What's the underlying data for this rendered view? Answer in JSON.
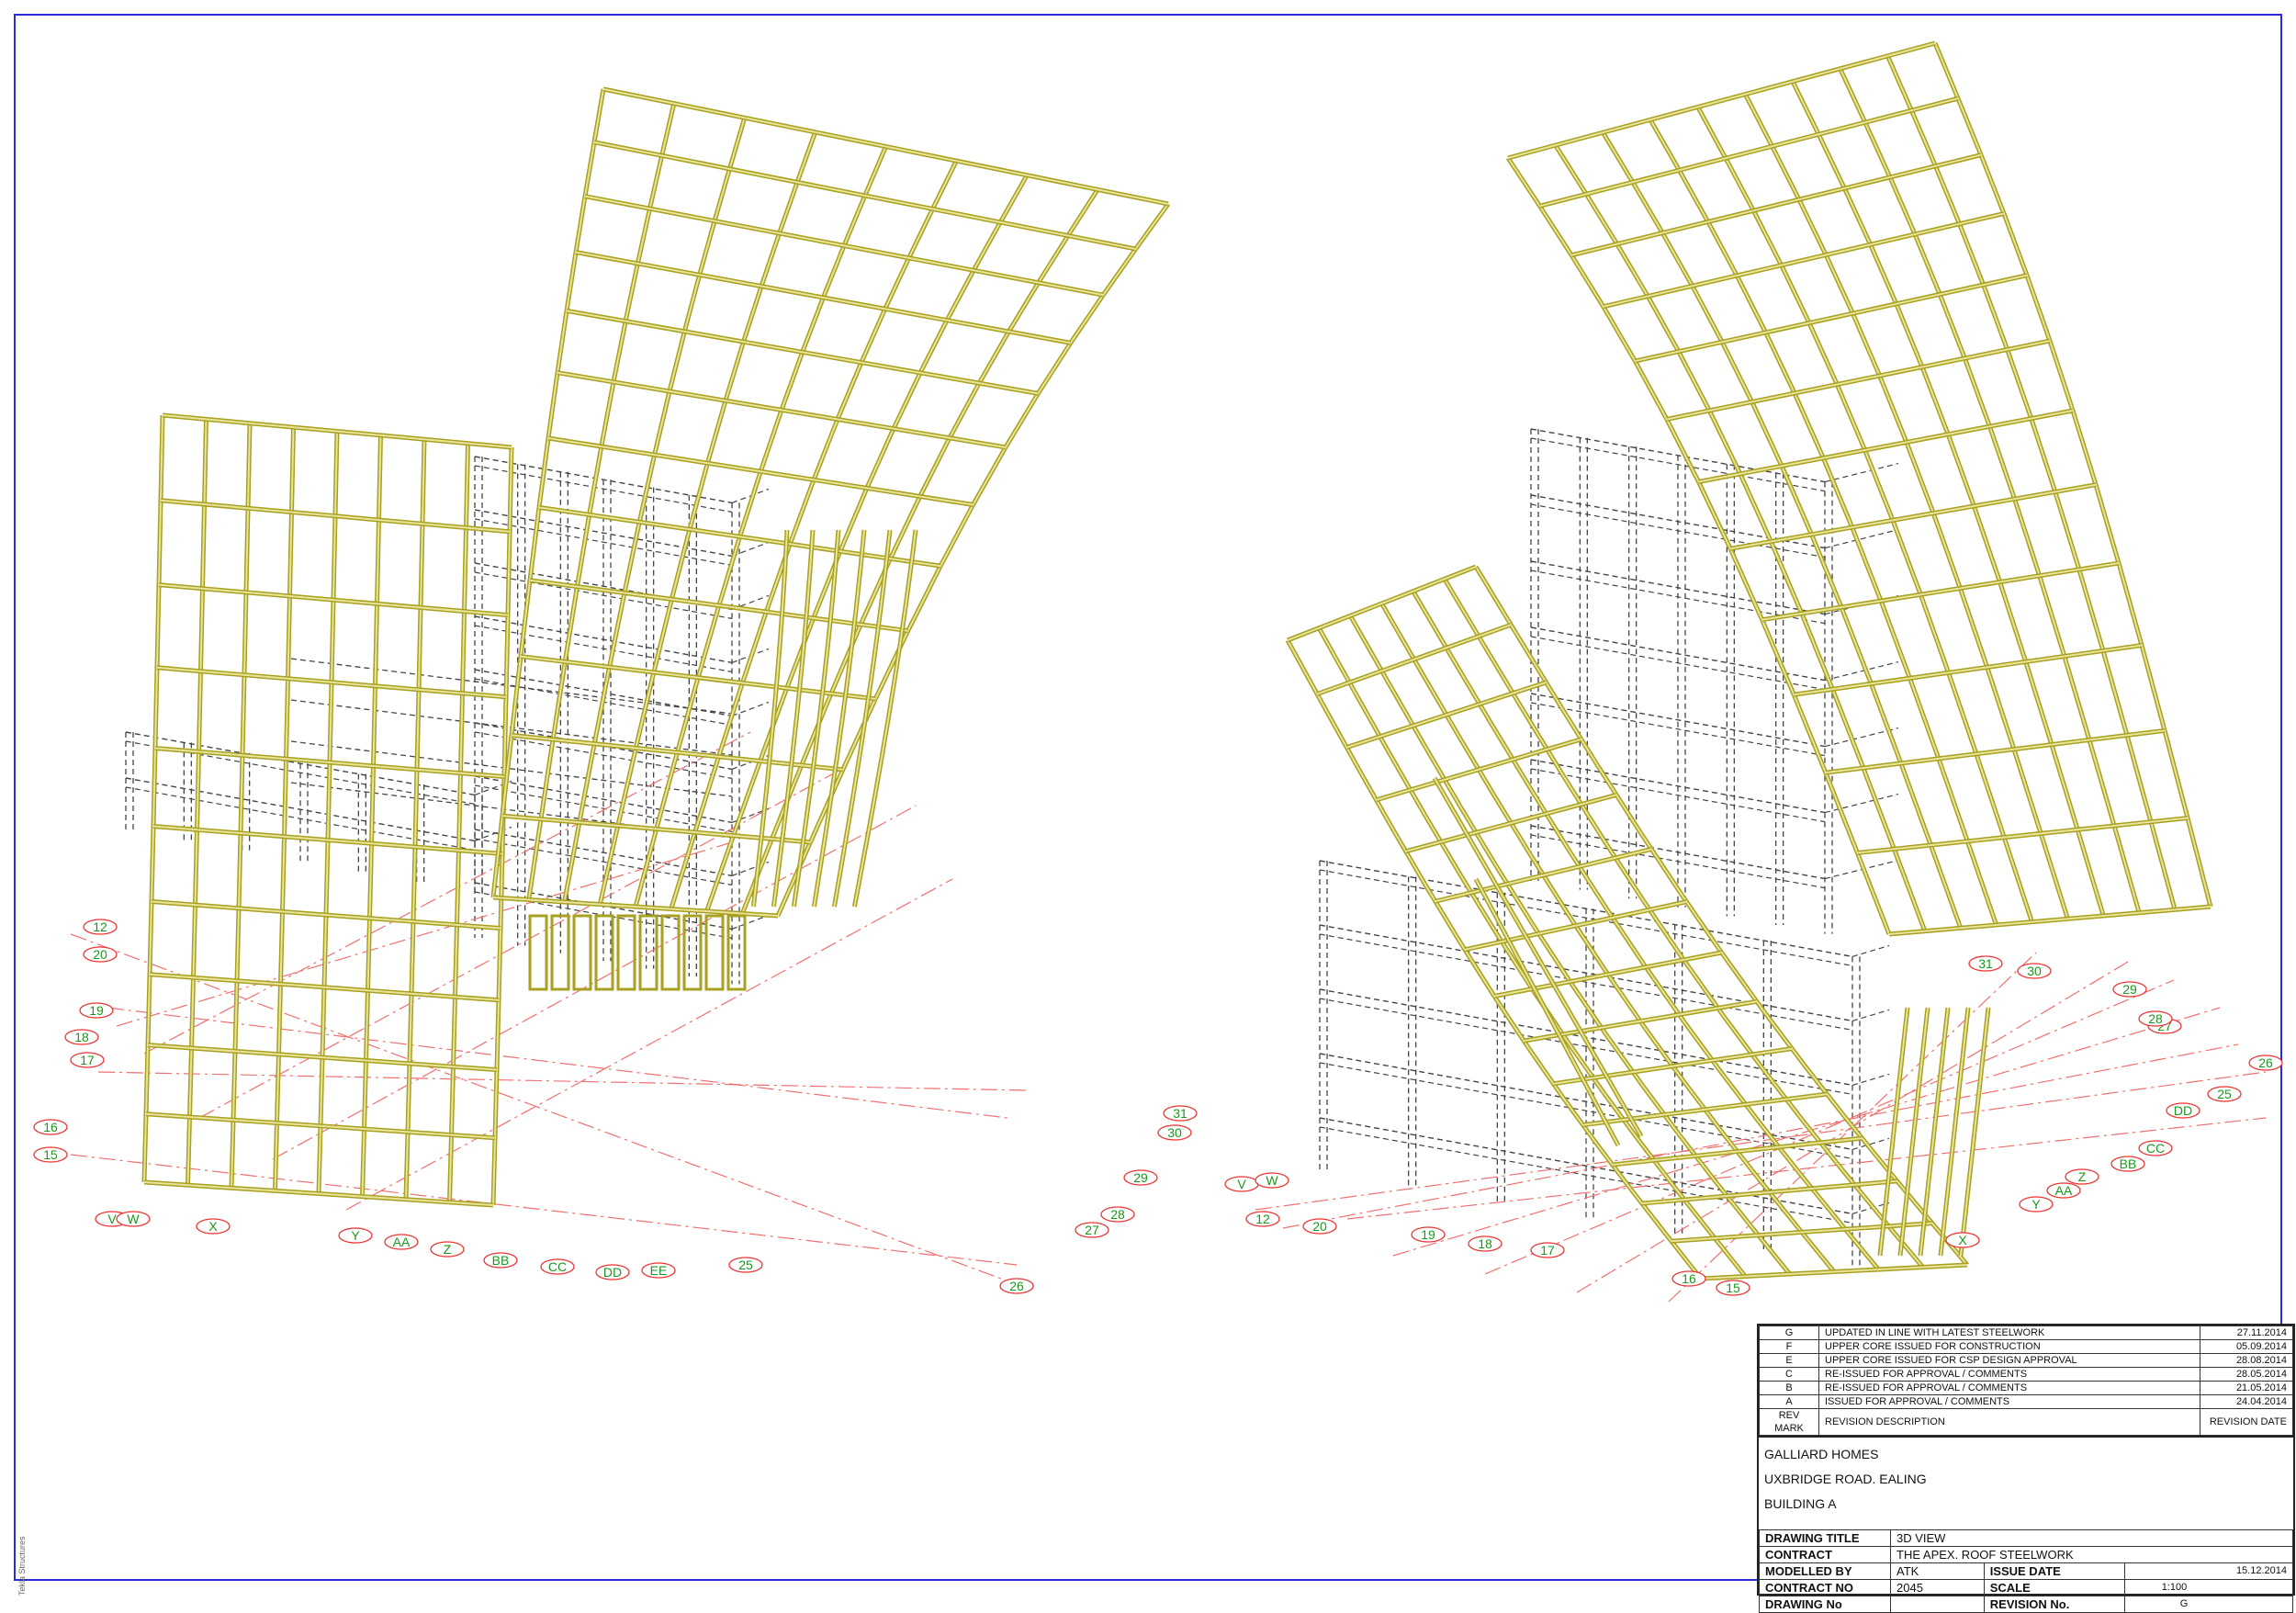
{
  "grid_tags": {
    "left": [
      "12",
      "20",
      "19",
      "18",
      "17",
      "16",
      "15",
      "V",
      "W",
      "X",
      "Y",
      "AA",
      "Z",
      "BB",
      "CC",
      "DD",
      "EE",
      "25",
      "26",
      "27",
      "28",
      "29",
      "30",
      "31"
    ],
    "right": [
      "V",
      "W",
      "12",
      "20",
      "19",
      "18",
      "17",
      "16",
      "15",
      "X",
      "Y",
      "AA",
      "Z",
      "BB",
      "CC",
      "DD",
      "25",
      "26",
      "27",
      "28",
      "31",
      "30",
      "29"
    ]
  },
  "revisions": [
    {
      "mark": "G",
      "desc": "UPDATED IN LINE WITH LATEST STEELWORK",
      "date": "27.11.2014"
    },
    {
      "mark": "F",
      "desc": "UPPER CORE ISSUED FOR CONSTRUCTION",
      "date": "05.09.2014"
    },
    {
      "mark": "E",
      "desc": "UPPER CORE ISSUED FOR CSP DESIGN APPROVAL",
      "date": "28.08.2014"
    },
    {
      "mark": "C",
      "desc": "RE-ISSUED FOR APPROVAL / COMMENTS",
      "date": "28.05.2014"
    },
    {
      "mark": "B",
      "desc": "RE-ISSUED FOR APPROVAL / COMMENTS",
      "date": "21.05.2014"
    },
    {
      "mark": "A",
      "desc": "ISSUED FOR APPROVAL / COMMENTS",
      "date": "24.04.2014"
    }
  ],
  "revision_header": {
    "mark": "REV MARK",
    "desc": "REVISION DESCRIPTION",
    "date": "REVISION DATE"
  },
  "project": {
    "client": "GALLIARD HOMES",
    "location": "UXBRIDGE ROAD. EALING",
    "building": "BUILDING A"
  },
  "info": {
    "drawing_title_label": "DRAWING TITLE",
    "drawing_title": "3D VIEW",
    "contract_label": "CONTRACT",
    "contract": "THE APEX. ROOF STEELWORK",
    "modelled_by_label": "MODELLED BY",
    "modelled_by": "ATK",
    "issue_date_label": "ISSUE DATE",
    "issue_date": "15.12.2014",
    "contract_no_label": "CONTRACT NO",
    "contract_no": "2045",
    "scale_label": "SCALE",
    "scale": "1:100",
    "drawing_no_label": "DRAWING No",
    "drawing_no": "",
    "revision_no_label": "REVISION No.",
    "revision_no": "G"
  },
  "credit": "Tekla Structures",
  "colors": {
    "steel": "#a8a020",
    "steel_fill": "#e8e49a",
    "border": "#2b2bd8",
    "grid_line": "#f07070",
    "tag_text": "#1a9a1a",
    "concrete": "#444444"
  }
}
